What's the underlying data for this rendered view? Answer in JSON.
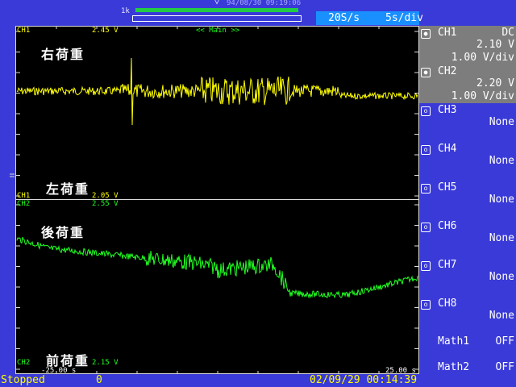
{
  "header": {
    "trigger_level_label": "1k",
    "timestamp": "94/08/30 09:19:06",
    "sample_rate": "20S/s",
    "time_div": "5s/div"
  },
  "screen": {
    "ch1": {
      "top_label": "CH1",
      "top_value": "2.45 V",
      "bottom_label": "CH1",
      "bottom_value": "2.05 V",
      "top_caption": "右荷重",
      "bottom_caption": "左荷重",
      "color": "#ffff00"
    },
    "ch2": {
      "top_label": "CH2",
      "top_value": "2.55 V",
      "bottom_label": "CH2",
      "bottom_value": "2.15 V",
      "top_caption": "後荷重",
      "bottom_caption": "前荷重",
      "color": "#22ff22"
    },
    "main_label": "<< Main >>",
    "time_left": "-25.00 s",
    "time_right": "25.00 s"
  },
  "channels": [
    {
      "name": "CH1",
      "coupling": "DC",
      "line2": "2.10 V",
      "line3": "1.00 V/div",
      "active": true
    },
    {
      "name": "CH2",
      "coupling": "",
      "line2": "2.20 V",
      "line3": "1.00 V/div",
      "active": true
    },
    {
      "name": "CH3",
      "coupling": "",
      "line2": "None",
      "line3": "",
      "active": false
    },
    {
      "name": "CH4",
      "coupling": "",
      "line2": "None",
      "line3": "",
      "active": false
    },
    {
      "name": "CH5",
      "coupling": "",
      "line2": "None",
      "line3": "",
      "active": false
    },
    {
      "name": "CH6",
      "coupling": "",
      "line2": "None",
      "line3": "",
      "active": false
    },
    {
      "name": "CH7",
      "coupling": "",
      "line2": "None",
      "line3": "",
      "active": false
    },
    {
      "name": "CH8",
      "coupling": "",
      "line2": "None",
      "line3": "",
      "active": false
    }
  ],
  "math": [
    {
      "name": "Math1",
      "state": "OFF"
    },
    {
      "name": "Math2",
      "state": "OFF"
    }
  ],
  "status": {
    "state": "Stopped",
    "count": "0",
    "datetime": "02/09/29 00:14:39"
  }
}
